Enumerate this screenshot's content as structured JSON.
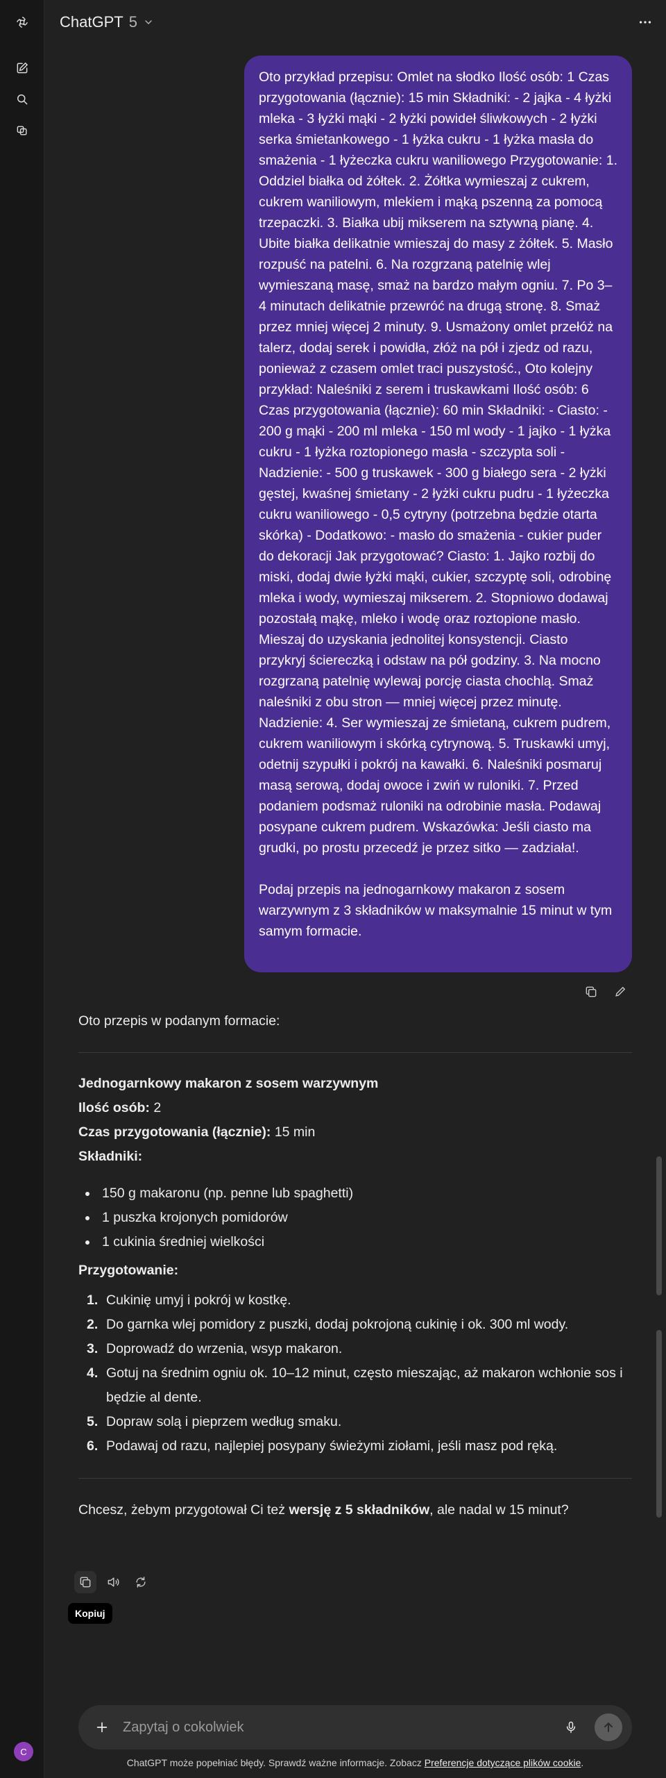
{
  "header": {
    "app_name": "ChatGPT",
    "model_version": "5",
    "more_icon": "ellipsis-icon"
  },
  "rail": {
    "icons": [
      "openai-logo-icon",
      "new-chat-icon",
      "search-icon",
      "library-icon"
    ],
    "avatar_initial": "C"
  },
  "user_message": {
    "text": "Oto przykład przepisu: Omlet na słodko Ilość osób: 1 Czas przygotowania (łącznie): 15 min Składniki: - 2 jajka - 4 łyżki mleka - 3 łyżki mąki - 2 łyżki powideł śliwkowych - 2 łyżki serka śmietankowego - 1 łyżka cukru - 1 łyżka masła do smażenia - 1 łyżeczka cukru waniliowego Przygotowanie: 1. Oddziel białka od żółtek. 2. Żółtka wymieszaj z cukrem, cukrem waniliowym, mlekiem i mąką pszenną za pomocą trzepaczki. 3. Białka ubij mikserem na sztywną pianę. 4. Ubite białka delikatnie wmieszaj do masy z żółtek. 5. Masło rozpuść na patelni. 6. Na rozgrzaną patelnię wlej wymieszaną masę, smaż na bardzo małym ogniu. 7. Po 3–4 minutach delikatnie przewróć na drugą stronę. 8. Smaż przez mniej więcej 2 minuty. 9. Usmażony omlet przełóż na talerz, dodaj serek i powidła, złóż na pół i zjedz od razu, ponieważ z czasem omlet traci puszystość., Oto kolejny przykład: Naleśniki z serem i truskawkami Ilość osób: 6 Czas przygotowania (łącznie): 60 min Składniki: - Ciasto: - 200 g mąki - 200 ml mleka - 150 ml wody - 1 jajko - 1 łyżka cukru - 1 łyżka roztopionego masła - szczypta soli - Nadzienie: - 500 g truskawek - 300 g białego sera - 2 łyżki gęstej, kwaśnej śmietany - 2 łyżki cukru pudru - 1 łyżeczka cukru waniliowego - 0,5 cytryny (potrzebna będzie otarta skórka) - Dodatkowo: - masło do smażenia - cukier puder do dekoracji Jak przygotować? Ciasto: 1. Jajko rozbij do miski, dodaj dwie łyżki mąki, cukier, szczyptę soli, odrobinę mleka i wody, wymieszaj mikserem. 2. Stopniowo dodawaj pozostałą mąkę, mleko i wodę oraz roztopione masło. Mieszaj do uzyskania jednolitej konsystencji. Ciasto przykryj ściereczką i odstaw na pół godziny. 3. Na mocno rozgrzaną patelnię wylewaj porcję ciasta chochlą. Smaż naleśniki z obu stron — mniej więcej przez minutę. Nadzienie: 4. Ser wymieszaj ze śmietaną, cukrem pudrem, cukrem waniliowym i skórką cytrynową. 5. Truskawki umyj, odetnij szypułki i pokrój na kawałki. 6. Naleśniki posmaruj masą serową, dodaj owoce i zwiń w ruloniki. 7. Przed podaniem podsmaż ruloniki na odrobinie masła. Podawaj posypane cukrem pudrem. Wskazówka: Jeśli ciasto ma grudki, po prostu przecedź je przez sitko — zadziała!.\n\nPodaj przepis na jednogarnkowy makaron z sosem warzywnym z 3 składników w maksymalnie 15 minut w tym samym formacie.",
    "actions": [
      "copy-icon",
      "edit-icon"
    ]
  },
  "assistant": {
    "intro": "Oto przepis w podanym formacie:",
    "recipe_title": "Jednogarnkowy makaron z sosem warzywnym",
    "servings_label": "Ilość osób:",
    "servings_value": "2",
    "time_label": "Czas przygotowania (łącznie):",
    "time_value": "15 min",
    "ingredients_heading": "Składniki:",
    "ingredients": [
      "150 g makaronu (np. penne lub spaghetti)",
      "1 puszka krojonych pomidorów",
      "1 cukinia średniej wielkości"
    ],
    "steps_heading": "Przygotowanie:",
    "steps": [
      {
        "num": "1.",
        "text": "Cukinię umyj i pokrój w kostkę."
      },
      {
        "num": "2.",
        "text": "Do garnka wlej pomidory z puszki, dodaj pokrojoną cukinię i ok. 300 ml wody."
      },
      {
        "num": "3.",
        "text": "Doprowadź do wrzenia, wsyp makaron."
      },
      {
        "num": "4.",
        "text": "Gotuj na średnim ogniu ok. 10–12 minut, często mieszając, aż makaron wchłonie sos i będzie al dente."
      },
      {
        "num": "5.",
        "text": "Dopraw solą i pieprzem według smaku."
      },
      {
        "num": "6.",
        "text": "Podawaj od razu, najlepiej posypany świeżymi ziołami, jeśli masz pod ręką."
      }
    ],
    "followup_pre": "Chcesz, żebym przygotował Ci też ",
    "followup_bold": "wersję z 5 składników",
    "followup_post": ", ale nadal w 15 minut?",
    "actions": [
      "copy-icon",
      "speaker-icon",
      "regenerate-icon"
    ],
    "tooltip": "Kopiuj"
  },
  "composer": {
    "placeholder": "Zapytaj o cokolwiek",
    "icons": [
      "plus-icon",
      "microphone-icon",
      "send-arrow-icon"
    ]
  },
  "footer": {
    "disclaimer_text": "ChatGPT może popełniać błędy. Sprawdź ważne informacje. Zobacz ",
    "disclaimer_link": "Preferencje dotyczące plików cookie",
    "disclaimer_end": "."
  },
  "colors": {
    "background": "#212121",
    "rail": "#171717",
    "user_bubble": "#4b2e91",
    "composer": "#303030",
    "avatar": "#8e3fb8"
  }
}
